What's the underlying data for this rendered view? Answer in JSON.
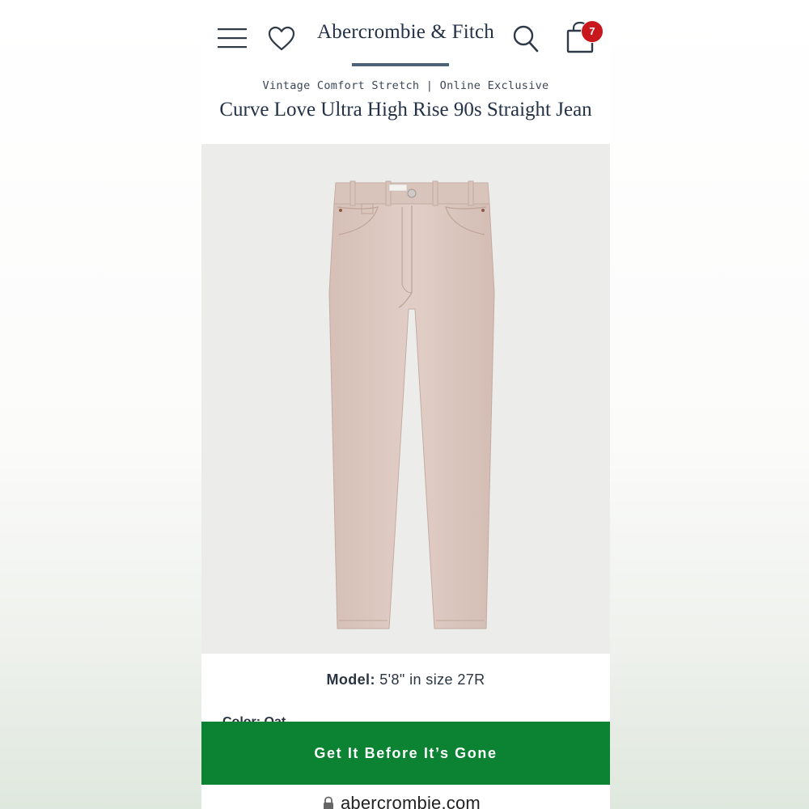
{
  "header": {
    "brand": "Abercrombie & Fitch",
    "cart_count": "7",
    "icons": [
      "menu-icon",
      "heart-icon",
      "search-icon",
      "bag-icon"
    ]
  },
  "product": {
    "subtitle": "Vintage Comfort Stretch | Online Exclusive",
    "title": "Curve Love Ultra High Rise 90s Straight Jean",
    "image_color": "#dcc7bf"
  },
  "model_info": {
    "label": "Model:",
    "value": "5'8\" in size 27R"
  },
  "color_peek": "Color: Oat",
  "cta": {
    "label": "Get It Before It’s Gone",
    "color": "#0b8332"
  },
  "browser": {
    "url": "abercrombie.com"
  },
  "colors": {
    "brand_text": "#233247",
    "badge": "#c8181e"
  }
}
